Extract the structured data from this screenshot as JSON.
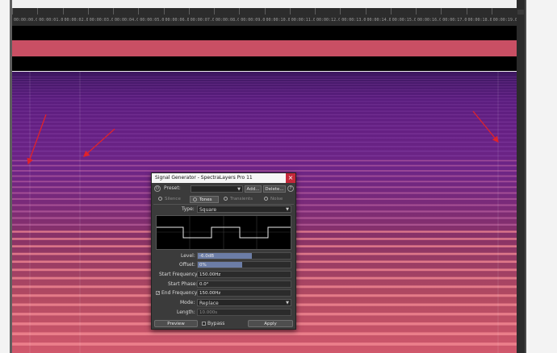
{
  "timeline": {
    "labels": [
      "00:00:00.000",
      "00:00:01.000",
      "00:00:02.000",
      "00:00:03.000",
      "00:00:04.000",
      "00:00:05.000",
      "00:00:06.000",
      "00:00:07.000",
      "00:00:08.000",
      "00:00:09.000",
      "00:00:10.000",
      "00:00:11.000",
      "00:00:12.000",
      "00:00:13.000",
      "00:00:14.000",
      "00:00:15.000",
      "00:00:16.000",
      "00:00:17.000",
      "00:00:18.000",
      "00:00:19.000"
    ]
  },
  "colors": {
    "band_red": "#c94f64",
    "spectrum_top": "#3d1860",
    "spectrum_bottom": "#d0586c",
    "annotation_arrow": "#e0222a",
    "close_button": "#c4283a",
    "slider_fill": "#6c7da6"
  },
  "dialog": {
    "title": "Signal Generator - SpectraLayers Pro 11",
    "close_icon": "×",
    "preset_label": "Preset:",
    "preset_value": "",
    "add_button": "Add...",
    "delete_button": "Delete...",
    "help_icon": "?",
    "power_icon": "⏻",
    "tabs": [
      "Silence",
      "Tones",
      "Transients",
      "Noise"
    ],
    "active_tab": "Tones",
    "type_label": "Type:",
    "type_value": "Square",
    "level_label": "Level:",
    "level_value": "-6.0dB",
    "level_fraction": 0.58,
    "offset_label": "Offset:",
    "offset_value": "0%",
    "offset_fraction": 0.48,
    "start_freq_label": "Start Frequency:",
    "start_freq_value": "150.00Hz",
    "start_phase_label": "Start Phase:",
    "start_phase_value": "0.0°",
    "end_freq_checked": true,
    "end_freq_label": "End Frequency:",
    "end_freq_value": "150.00Hz",
    "mode_label": "Mode:",
    "mode_value": "Replace",
    "length_label": "Length:",
    "length_value": "10.000s",
    "preview_button": "Preview",
    "bypass_label": "Bypass",
    "bypass_checked": false,
    "apply_button": "Apply"
  }
}
